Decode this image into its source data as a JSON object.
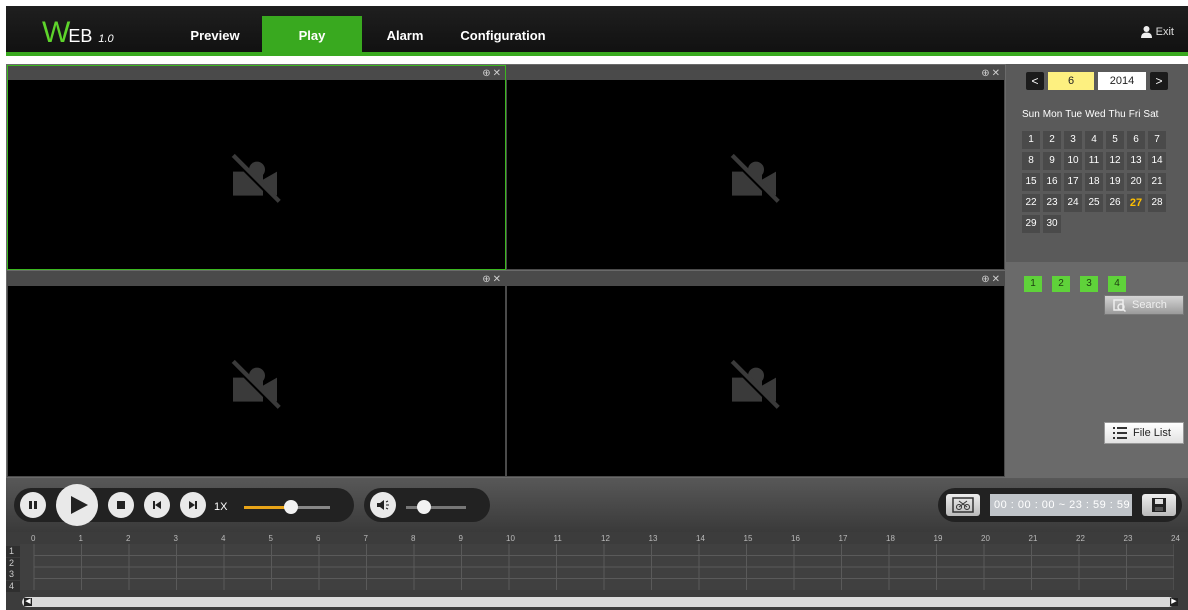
{
  "header": {
    "logo_w": "W",
    "logo_rest": "EB",
    "logo_version": "1.0",
    "nav": [
      {
        "label": "Preview",
        "active": false
      },
      {
        "label": "Play",
        "active": true
      },
      {
        "label": "Alarm",
        "active": false
      },
      {
        "label": "Configuration",
        "active": false
      }
    ],
    "exit_label": "Exit",
    "accent": "#39a91f"
  },
  "video": {
    "cells": [
      {
        "channel": 1,
        "selected": true,
        "icon": "no-camera-icon"
      },
      {
        "channel": 2,
        "selected": false,
        "icon": "no-camera-icon"
      },
      {
        "channel": 3,
        "selected": false,
        "icon": "no-camera-icon"
      },
      {
        "channel": 4,
        "selected": false,
        "icon": "no-camera-icon"
      }
    ]
  },
  "calendar": {
    "prev": "<",
    "next": ">",
    "month": "6",
    "year": "2014",
    "weekdays": [
      "Sun",
      "Mon",
      "Tue",
      "Wed",
      "Thu",
      "Fri",
      "Sat"
    ],
    "days": [
      "1",
      "2",
      "3",
      "4",
      "5",
      "6",
      "7",
      "8",
      "9",
      "10",
      "11",
      "12",
      "13",
      "14",
      "15",
      "16",
      "17",
      "18",
      "19",
      "20",
      "21",
      "22",
      "23",
      "24",
      "25",
      "26",
      "27",
      "28",
      "29",
      "30"
    ],
    "today": "27",
    "today_color": "#ffbf00"
  },
  "channels": [
    "1",
    "2",
    "3",
    "4"
  ],
  "search_label": "Search",
  "file_list_label": "File List",
  "playback": {
    "speed_label": "1X",
    "speed_level": 0.55,
    "volume_level": 0.3
  },
  "time_range": {
    "text": "00 : 00 : 00 ~ 23 : 59 : 59"
  },
  "timeline": {
    "hours": [
      "0",
      "1",
      "2",
      "3",
      "4",
      "5",
      "6",
      "7",
      "8",
      "9",
      "10",
      "11",
      "12",
      "13",
      "14",
      "15",
      "16",
      "17",
      "18",
      "19",
      "20",
      "21",
      "22",
      "23",
      "24"
    ],
    "rows": [
      "1",
      "2",
      "3",
      "4"
    ]
  }
}
